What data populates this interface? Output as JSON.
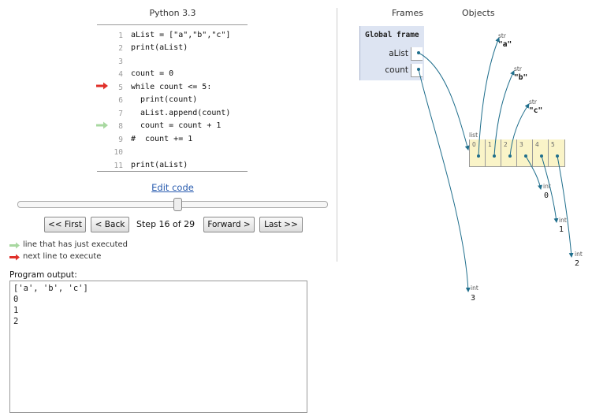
{
  "visualizer": {
    "language": "Python 3.3",
    "code_lines": [
      {
        "num": "1",
        "text": "aList = [\"a\",\"b\",\"c\"]"
      },
      {
        "num": "2",
        "text": "print(aList)"
      },
      {
        "num": "3",
        "text": ""
      },
      {
        "num": "4",
        "text": "count = 0"
      },
      {
        "num": "5",
        "text": "while count <= 5:"
      },
      {
        "num": "6",
        "text": "  print(count)"
      },
      {
        "num": "7",
        "text": "  aList.append(count)"
      },
      {
        "num": "8",
        "text": "  count = count + 1"
      },
      {
        "num": "9",
        "text": "#  count += 1"
      },
      {
        "num": "10",
        "text": ""
      },
      {
        "num": "11",
        "text": "print(aList)"
      }
    ],
    "edit_code_link": "Edit code",
    "slider_progress": 0.517,
    "buttons": {
      "first": "<< First",
      "back": "< Back",
      "forward": "Forward >",
      "last": "Last >>"
    },
    "step_text": "Step 16 of 29",
    "legend": {
      "just_executed": "line that has just executed",
      "next_line": "next line to execute"
    },
    "colors": {
      "just_executed_arrow": "#a8d8a0",
      "next_line_arrow": "#e0302a",
      "link": "#2a5db0",
      "frame_bg": "#dde4f2",
      "list_bg": "#faf4c8",
      "pointer": "#1f6e8c"
    },
    "output": {
      "label": "Program output:",
      "lines": [
        "['a', 'b', 'c']",
        "0",
        "1",
        "2"
      ]
    }
  },
  "heap": {
    "frames_header": "Frames",
    "objects_header": "Objects",
    "global_frame": {
      "title": "Global frame",
      "vars": [
        "aList",
        "count"
      ]
    },
    "strings": [
      {
        "type": "str",
        "value": "\"a\""
      },
      {
        "type": "str",
        "value": "\"b\""
      },
      {
        "type": "str",
        "value": "\"c\""
      }
    ],
    "list": {
      "type": "list",
      "indices": [
        "0",
        "1",
        "2",
        "3",
        "4",
        "5"
      ]
    },
    "ints": [
      {
        "type": "int",
        "value": "0"
      },
      {
        "type": "int",
        "value": "1"
      },
      {
        "type": "int",
        "value": "2"
      },
      {
        "type": "int",
        "value": "3"
      }
    ]
  }
}
